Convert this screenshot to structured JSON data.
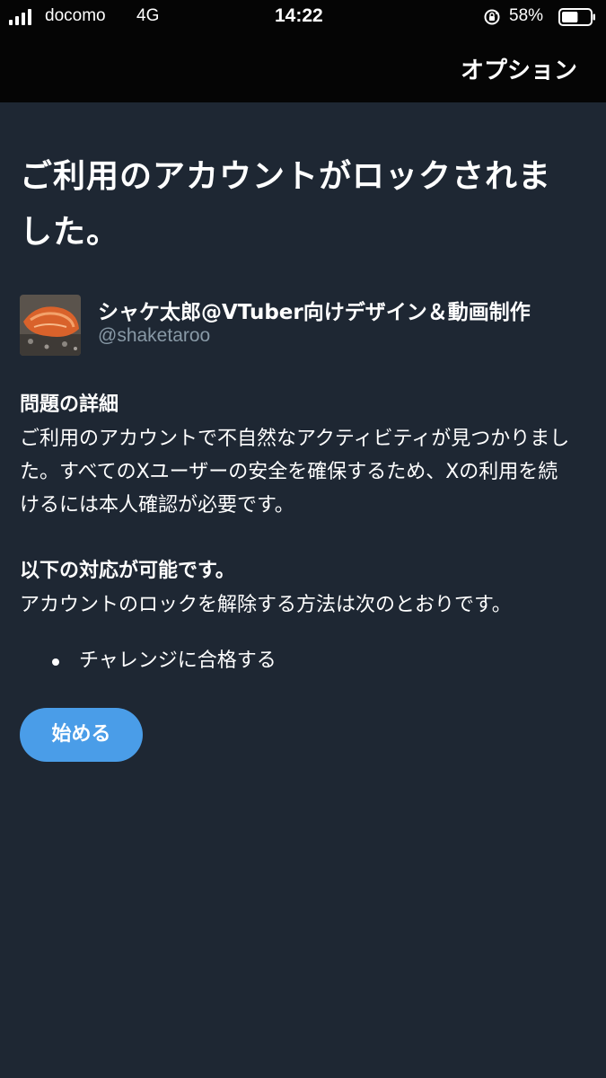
{
  "status_bar": {
    "carrier": "docomo",
    "network": "4G",
    "time": "14:22",
    "battery_percent": "58%",
    "battery_level": 0.58
  },
  "header": {
    "options_label": "オプション"
  },
  "page": {
    "title": "ご利用のアカウントがロックされました。"
  },
  "account": {
    "display_name": "シャケ太郎@VTuber向けデザイン＆動画制作",
    "handle": "@shaketaroo"
  },
  "details": {
    "heading": "問題の詳細",
    "body": "ご利用のアカウントで不自然なアクティビティが見つかりました。すべてのXユーザーの安全を確保するため、Xの利用を続けるには本人確認が必要です。"
  },
  "options": {
    "heading": "以下の対応が可能です。",
    "body": "アカウントのロックを解除する方法は次のとおりです。",
    "items": [
      "チャレンジに合格する"
    ]
  },
  "actions": {
    "start_label": "始める"
  },
  "colors": {
    "background": "#1e2733",
    "topbar": "#050505",
    "accent": "#4a9de8",
    "secondary_text": "#8899a6"
  }
}
